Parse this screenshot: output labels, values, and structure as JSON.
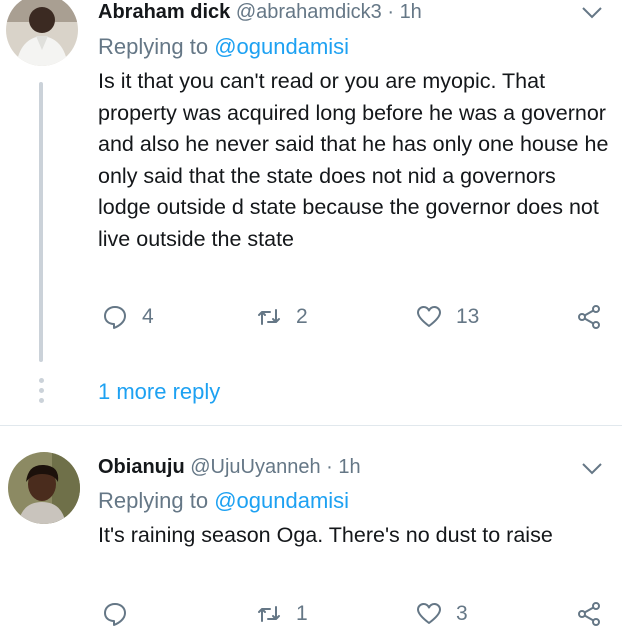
{
  "tweets": [
    {
      "name": "Abraham dick",
      "handle": "@abrahamdick3",
      "separator": "·",
      "time": "1h",
      "replying_prefix": "Replying to",
      "replying_to": "@ogundamisi",
      "text": "Is it that you can't read or you are myopic. That property was acquired long before he was a governor and also he never said that he has only one house he only said that the state does not nid a governors lodge outside d state because the governor does not live outside the state",
      "replies": "4",
      "retweets": "2",
      "likes": "13"
    },
    {
      "name": "Obianuju",
      "handle": "@UjuUyanneh",
      "separator": "·",
      "time": "1h",
      "replying_prefix": "Replying to",
      "replying_to": "@ogundamisi",
      "text": "It's raining season Oga. There's no dust to raise",
      "replies": "",
      "retweets": "1",
      "likes": "3"
    }
  ],
  "more_replies_label": "1 more reply",
  "icons": {
    "reply": "reply-icon",
    "retweet": "retweet-icon",
    "like": "heart-icon",
    "share": "share-icon",
    "menu": "chevron-down-icon"
  },
  "colors": {
    "accent": "#1da1f2",
    "secondary_text": "#657786",
    "thread_line": "#cbd2d9"
  }
}
